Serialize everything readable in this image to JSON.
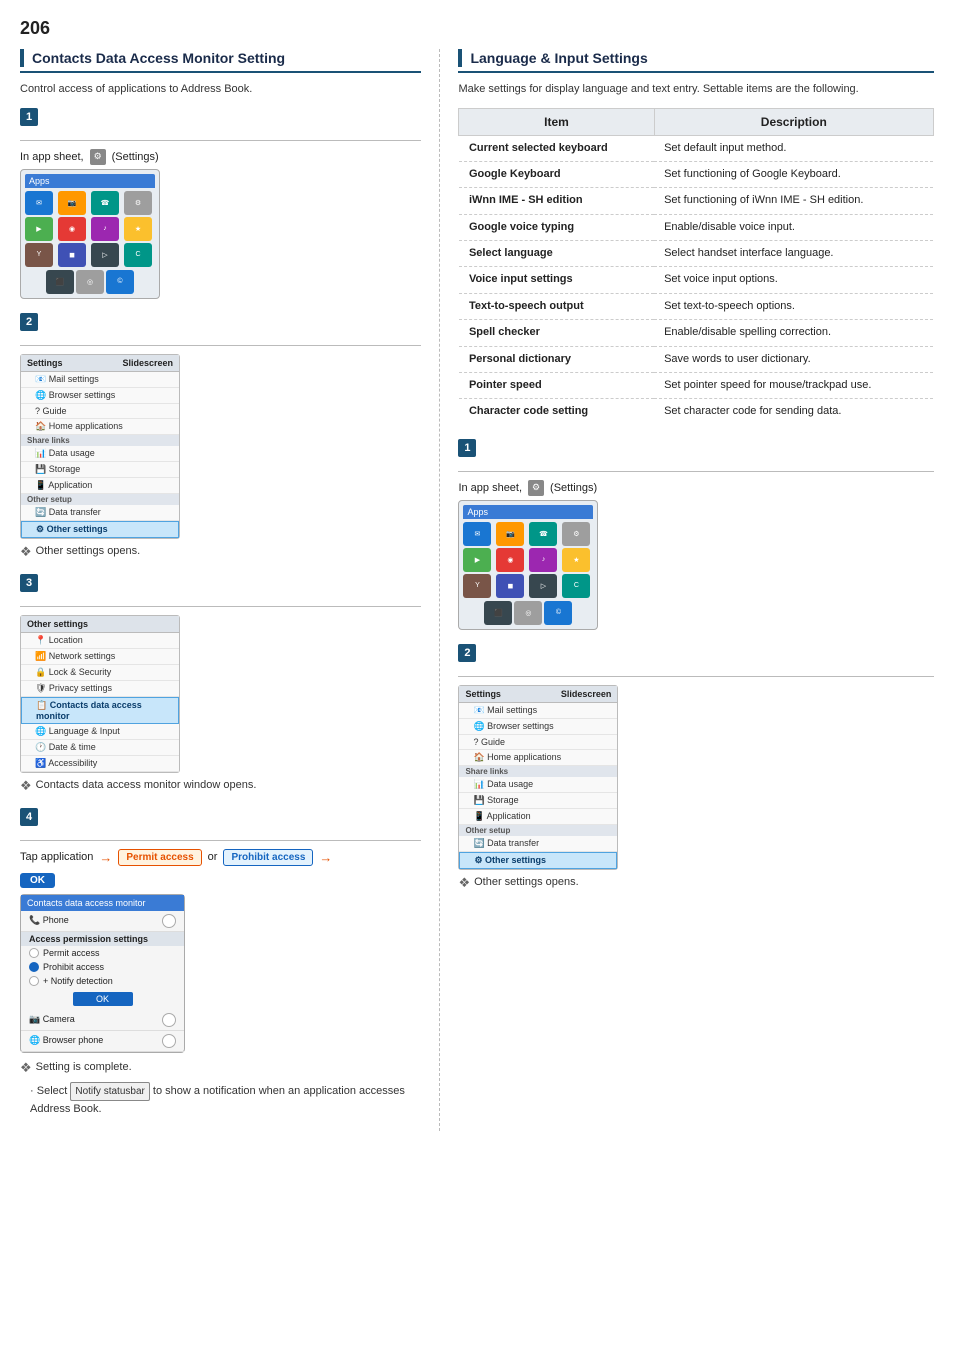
{
  "page": {
    "number": "206"
  },
  "left_section": {
    "title": "Contacts Data Access Monitor Setting",
    "description": "Control access of applications to Address Book.",
    "step1": {
      "label": "1",
      "inline_text": "In app sheet,",
      "settings_text": "(Settings)"
    },
    "step2": {
      "label": "2",
      "highlighted_item": "Other settings",
      "menu_items": [
        "Mail settings",
        "Browser settings",
        "Guide",
        "Home applications",
        "Data usage",
        "Storage",
        "Application",
        "Data transfer",
        "Other settings"
      ],
      "section_labels": [
        "Share links",
        "Other setup"
      ],
      "note": "Other settings opens."
    },
    "step3": {
      "label": "3",
      "highlighted_item": "Contacts data access monitor",
      "menu_items": [
        "Location",
        "Network settings",
        "Lock & Security",
        "Privacy settings",
        "Contacts data access monitor",
        "Language & Input",
        "Date & time",
        "Accessibility"
      ],
      "note": "Contacts data access monitor window opens."
    },
    "step4": {
      "label": "4",
      "tap_text": "Tap application",
      "arrow1": "→",
      "permit_label": "Permit access",
      "or_text": "or",
      "prohibit_label": "Prohibit access",
      "arrow2": "→",
      "ok_label": "OK",
      "access_screen": {
        "header": "Contacts data access monitor",
        "list_items": [
          {
            "name": "Phone",
            "has_toggle": true
          },
          {
            "name": "Camera",
            "has_toggle": true
          },
          {
            "name": "Browser phone",
            "has_toggle": true
          }
        ],
        "section": "Access permission settings",
        "radio_options": [
          {
            "label": "Permit access",
            "selected": false
          },
          {
            "label": "Prohibit access",
            "selected": true
          },
          {
            "label": "+ Notify detection",
            "selected": false
          }
        ],
        "ok_btn": "OK"
      },
      "complete_note": "Setting is complete.",
      "bullet_text": "Select",
      "notify_badge": "Notify statusbar",
      "bullet_rest": "to show a notification when an application accesses Address Book."
    }
  },
  "right_section": {
    "title": "Language & Input Settings",
    "description": "Make settings for display language and text entry. Settable items are the following.",
    "table": {
      "col_item": "Item",
      "col_desc": "Description",
      "rows": [
        {
          "item": "Current selected keyboard",
          "desc": "Set default input method."
        },
        {
          "item": "Google Keyboard",
          "desc": "Set functioning of Google Keyboard."
        },
        {
          "item": "iWnn IME - SH edition",
          "desc": "Set functioning of iWnn IME - SH edition."
        },
        {
          "item": "Google voice typing",
          "desc": "Enable/disable voice input."
        },
        {
          "item": "Select language",
          "desc": "Select handset interface language."
        },
        {
          "item": "Voice input settings",
          "desc": "Set voice input options."
        },
        {
          "item": "Text-to-speech output",
          "desc": "Set text-to-speech options."
        },
        {
          "item": "Spell checker",
          "desc": "Enable/disable spelling correction."
        },
        {
          "item": "Personal dictionary",
          "desc": "Save words to user dictionary."
        },
        {
          "item": "Pointer speed",
          "desc": "Set pointer speed for mouse/trackpad use."
        },
        {
          "item": "Character code setting",
          "desc": "Set character code for sending data."
        }
      ]
    },
    "step1": {
      "label": "1",
      "inline_text": "In app sheet,",
      "settings_text": "(Settings)"
    },
    "step2": {
      "label": "2",
      "highlighted_item": "Other settings",
      "menu_items": [
        "Mail settings",
        "Browser settings",
        "Guide",
        "Home applications",
        "Data usage",
        "Storage",
        "Application",
        "Data transfer",
        "Other settings"
      ],
      "section_labels": [
        "Share links",
        "Other setup"
      ],
      "note": "Other settings opens."
    }
  },
  "icons": {
    "settings": "⚙",
    "note_symbol": "❖",
    "arrow": "→",
    "bullet": "•"
  }
}
